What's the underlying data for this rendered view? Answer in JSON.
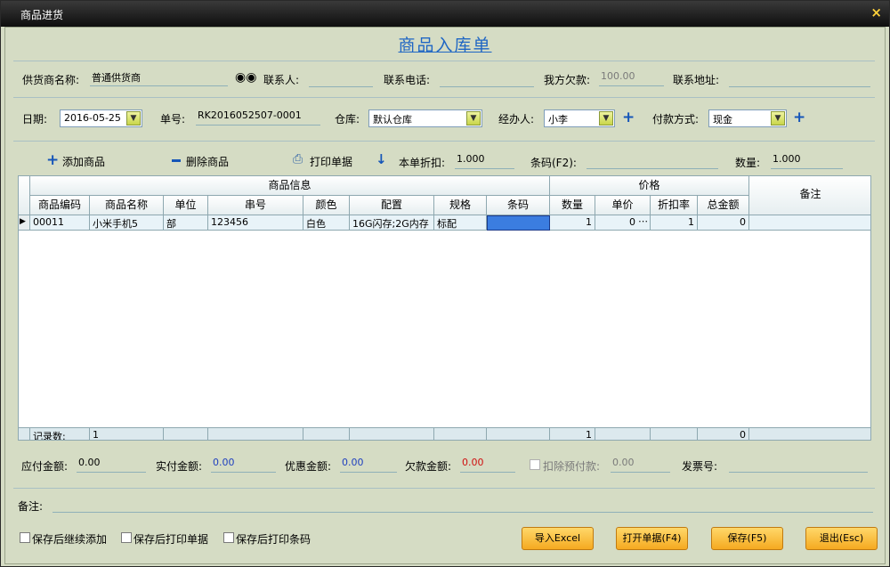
{
  "window": {
    "title": "商品进货",
    "close": "×"
  },
  "doc_title": "商品入库单",
  "supplier": {
    "label": "供货商名称:",
    "value": "普通供货商",
    "contact_label": "联系人:",
    "contact_value": "",
    "phone_label": "联系电话:",
    "phone_value": "",
    "debt_label": "我方欠款:",
    "debt_value": "100.00",
    "address_label": "联系地址:",
    "address_value": ""
  },
  "order": {
    "date_label": "日期:",
    "date_value": "2016-05-25",
    "no_label": "单号:",
    "no_value": "RK2016052507-0001",
    "warehouse_label": "仓库:",
    "warehouse_value": "默认仓库",
    "handler_label": "经办人:",
    "handler_value": "小李",
    "pay_label": "付款方式:",
    "pay_value": "现金"
  },
  "toolbar": {
    "add": "添加商品",
    "delete": "删除商品",
    "print": "打印单据",
    "discount_label": "本单折扣:",
    "discount_value": "1.000",
    "barcode_label": "条码(F2):",
    "barcode_value": "",
    "qty_label": "数量:",
    "qty_value": "1.000"
  },
  "grid": {
    "group_info": "商品信息",
    "group_price": "价格",
    "notes_header": "备注",
    "columns": [
      "商品编码",
      "商品名称",
      "单位",
      "串号",
      "颜色",
      "配置",
      "规格",
      "条码",
      "数量",
      "单价",
      "折扣率",
      "总金额"
    ],
    "rows": [
      [
        "00011",
        "小米手机5",
        "部",
        "123456",
        "白色",
        "16G闪存;2G内存",
        "标配",
        "",
        "1",
        "0",
        "1",
        "0"
      ]
    ],
    "footer": {
      "label": "记录数:",
      "count": "1",
      "qty_total": "1",
      "amount_total": "0"
    }
  },
  "totals": {
    "payable_label": "应付金额:",
    "payable": "0.00",
    "paid_label": "实付金额:",
    "paid": "0.00",
    "discount_label": "优惠金额:",
    "discount": "0.00",
    "owed_label": "欠款金额:",
    "owed": "0.00",
    "deduct_label": "扣除预付款:",
    "deduct": "0.00",
    "invoice_label": "发票号:",
    "invoice": ""
  },
  "remarks": {
    "label": "备注:",
    "value": ""
  },
  "options": [
    "保存后继续添加",
    "保存后打印单据",
    "保存后打印条码"
  ],
  "buttons": {
    "import": "导入Excel",
    "open": "打开单据(F4)",
    "save": "保存(F5)",
    "exit": "退出(Esc)"
  },
  "colors": {
    "title": "#1f66c4",
    "owed": "#d01010",
    "paid": "#1f3fbf",
    "button": "#f5a920"
  }
}
